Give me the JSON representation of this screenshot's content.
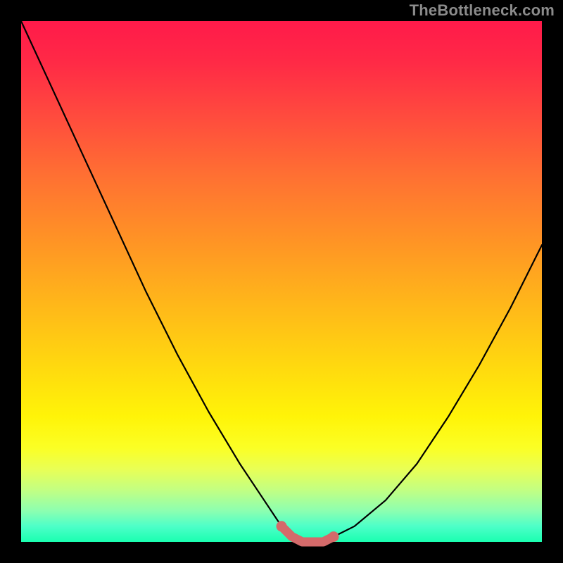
{
  "watermark": "TheBottleneck.com",
  "colors": {
    "page_bg": "#000000",
    "watermark_text": "#8b8b8b",
    "curve_stroke": "#000000",
    "indicator_fill": "#d46a6a",
    "indicator_stroke": "#b84f4f",
    "gradient_top": "#ff1a4a",
    "gradient_bottom": "#1affb0"
  },
  "chart_data": {
    "type": "line",
    "title": "",
    "xlabel": "",
    "ylabel": "",
    "xlim": [
      0,
      100
    ],
    "ylim": [
      0,
      100
    ],
    "grid": false,
    "legend": false,
    "series": [
      {
        "name": "bottleneck-curve",
        "x": [
          0,
          6,
          12,
          18,
          24,
          30,
          36,
          42,
          48,
          50,
          52,
          54,
          56,
          58,
          60,
          64,
          70,
          76,
          82,
          88,
          94,
          100
        ],
        "values": [
          100,
          87,
          74,
          61,
          48,
          36,
          25,
          15,
          6,
          3,
          1,
          0,
          0,
          0,
          1,
          3,
          8,
          15,
          24,
          34,
          45,
          57
        ]
      },
      {
        "name": "valley-indicator",
        "x": [
          50,
          52,
          54,
          56,
          58,
          60
        ],
        "values": [
          3,
          1,
          0,
          0,
          0,
          1
        ]
      }
    ],
    "annotations": []
  }
}
